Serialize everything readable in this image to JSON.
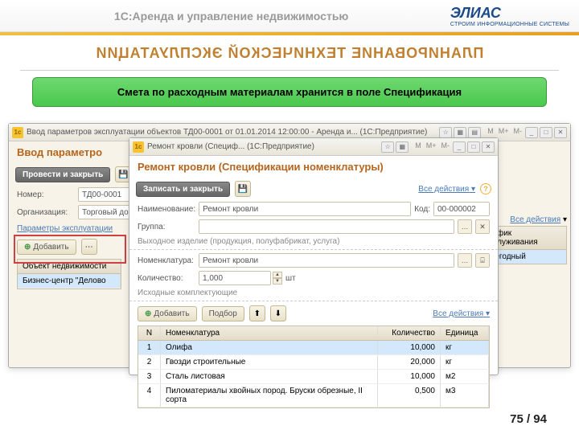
{
  "header": {
    "product_name": "1С:Аренда и управление недвижимостью",
    "logo_text": "ЭЛИАС",
    "logo_sub": "СТРОИМ ИНФОРМАЦИОННЫЕ СИСТЕМЫ"
  },
  "slide_title": "ПЛАНИРОВАНИЕ ТЕХНИЧЕСКОЙ ЭКСПЛУАТАЦИИ",
  "banner": "Смета по расходным материалам хранится в поле Спецификация",
  "back_window": {
    "title": "Ввод параметров эксплуатации объектов ТД00-0001 от 01.01.2014 12:00:00 - Аренда и...   (1С:Предприятие)",
    "doc_head": "Ввод параметро",
    "post_close": "Провести и закрыть",
    "nomer_lbl": "Номер:",
    "nomer_val": "ТД00-0001",
    "org_lbl": "Организация:",
    "org_val": "Торговый до",
    "params_lbl": "Параметры эксплуатации",
    "add": "Добавить",
    "col_obj": "Объект недвижимости",
    "row_obj": "Бизнес-центр \"Делово",
    "all_actions": "Все действия",
    "col_schedule": "График обслуживания",
    "schedule_val": "Ежегодный"
  },
  "front_window": {
    "title": "Ремонт кровли (Специф...   (1С:Предприятие)",
    "doc_head": "Ремонт кровли (Спецификации номенклатуры)",
    "save_close": "Записать и закрыть",
    "all_actions": "Все действия",
    "name_lbl": "Наименование:",
    "name_val": "Ремонт кровли",
    "code_lbl": "Код:",
    "code_val": "00-000002",
    "group_lbl": "Группа:",
    "group_val": "",
    "out_section": "Выходное изделие (продукция, полуфабрикат, услуга)",
    "nom_lbl": "Номенклатура:",
    "nom_val": "Ремонт кровли",
    "qty_lbl": "Количество:",
    "qty_val": "1,000",
    "qty_unit": "шт",
    "comp_section": "Исходные комплектующие",
    "add": "Добавить",
    "pick": "Подбор",
    "th_n": "N",
    "th_name": "Номенклатура",
    "th_qty": "Количество",
    "th_unit": "Единица",
    "rows": [
      {
        "n": "1",
        "name": "Олифа",
        "qty": "10,000",
        "unit": "кг"
      },
      {
        "n": "2",
        "name": "Гвозди строительные",
        "qty": "20,000",
        "unit": "кг"
      },
      {
        "n": "3",
        "name": "Сталь листовая",
        "qty": "10,000",
        "unit": "м2"
      },
      {
        "n": "4",
        "name": "Пиломатериалы хвойных пород. Бруски обрезные, II сорта",
        "qty": "0,500",
        "unit": "м3"
      }
    ]
  },
  "page": "75 / 94"
}
